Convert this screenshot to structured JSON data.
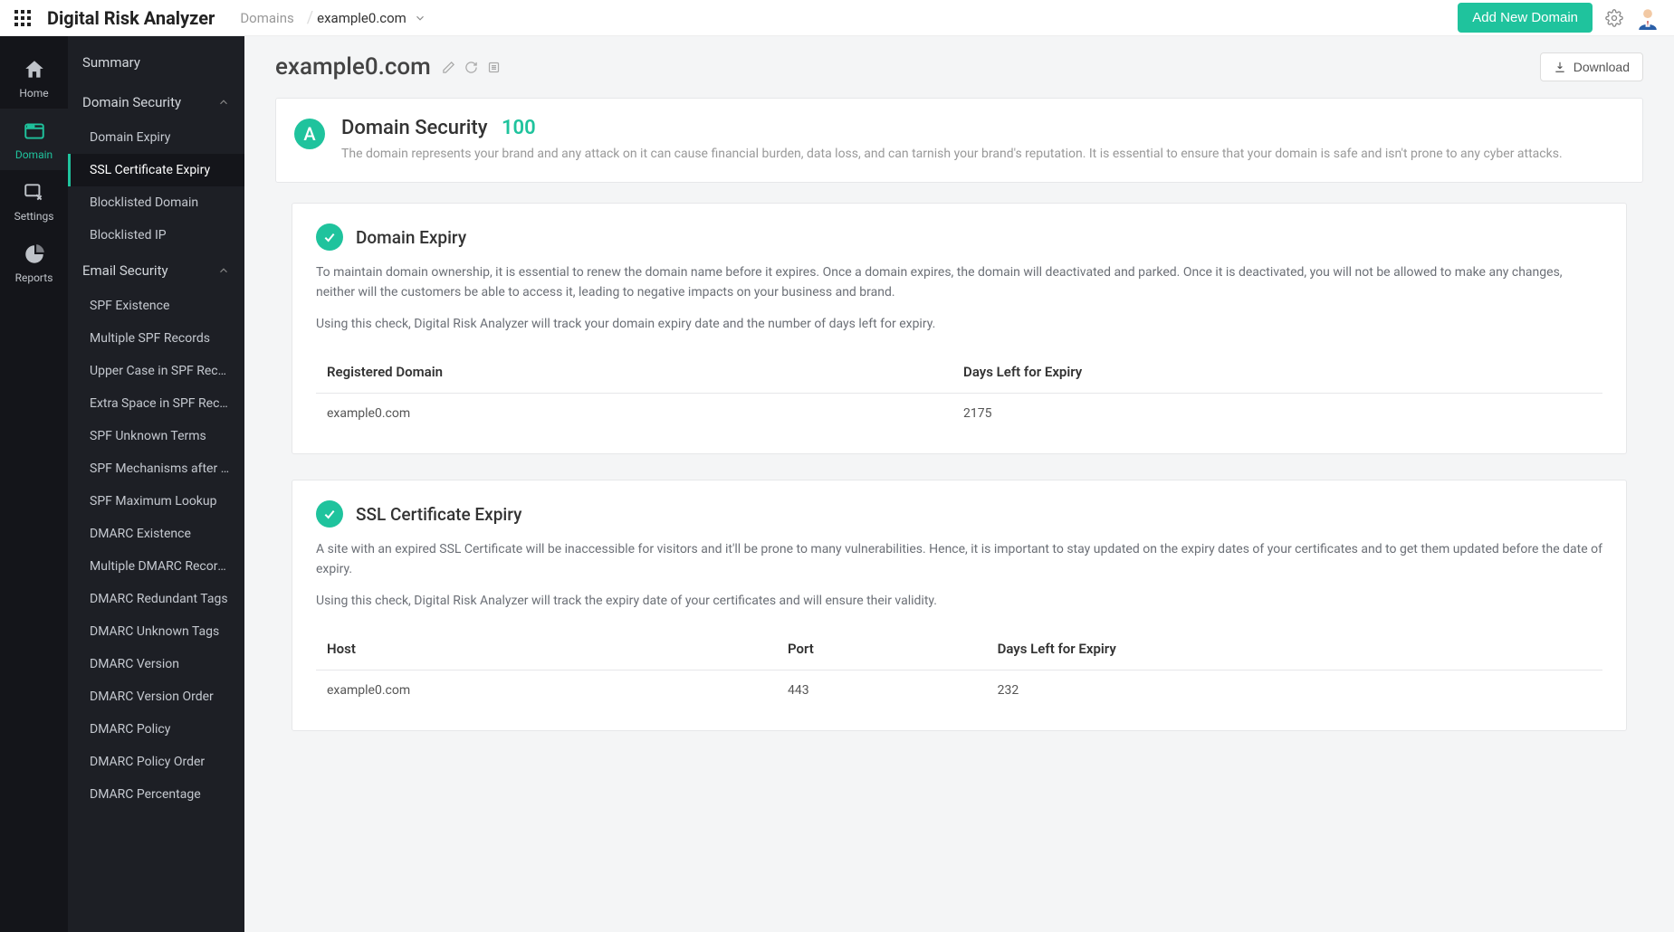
{
  "header": {
    "app_title": "Digital Risk Analyzer",
    "breadcrumb": "Domains",
    "selected_domain": "example0.com",
    "add_button": "Add New Domain"
  },
  "rail": [
    {
      "id": "home",
      "label": "Home"
    },
    {
      "id": "domain",
      "label": "Domain"
    },
    {
      "id": "settings",
      "label": "Settings"
    },
    {
      "id": "reports",
      "label": "Reports"
    }
  ],
  "sidebar": {
    "summary_label": "Summary",
    "groups": [
      {
        "label": "Domain Security",
        "items": [
          "Domain Expiry",
          "SSL Certificate Expiry",
          "Blocklisted Domain",
          "Blocklisted IP"
        ]
      },
      {
        "label": "Email Security",
        "items": [
          "SPF Existence",
          "Multiple SPF Records",
          "Upper Case in SPF Recor...",
          "Extra Space in SPF Record",
          "SPF Unknown Terms",
          "SPF Mechanisms after \"all\"",
          "SPF Maximum Lookup",
          "DMARC Existence",
          "Multiple DMARC Records",
          "DMARC Redundant Tags",
          "DMARC Unknown Tags",
          "DMARC Version",
          "DMARC Version Order",
          "DMARC Policy",
          "DMARC Policy Order",
          "DMARC Percentage"
        ]
      }
    ]
  },
  "page": {
    "title": "example0.com",
    "download_label": "Download"
  },
  "summary": {
    "grade": "A",
    "heading": "Domain Security",
    "score": "100",
    "description": "The domain represents your brand and any attack on it can cause financial burden, data loss, and can tarnish your brand's reputation. It is essential to ensure that your domain is safe and isn't prone to any cyber attacks."
  },
  "checks": [
    {
      "title": "Domain Expiry",
      "desc1": "To maintain domain ownership, it is essential to renew the domain name before it expires. Once a domain expires, the domain will deactivated and parked. Once it is deactivated, you will not be allowed to make any changes, neither will the customers be able to access it, leading to negative impacts on your business and brand.",
      "desc2": "Using this check, Digital Risk Analyzer will track your domain expiry date and the number of days left for expiry.",
      "columns": [
        "Registered Domain",
        "Days Left for Expiry"
      ],
      "rows": [
        [
          "example0.com",
          "2175"
        ]
      ]
    },
    {
      "title": "SSL Certificate Expiry",
      "desc1": "A site with an expired SSL Certificate will be inaccessible for visitors and it'll be prone to many vulnerabilities. Hence, it is important to stay updated on the expiry dates of your certificates and to get them updated before the date of expiry.",
      "desc2": "Using this check, Digital Risk Analyzer will track the expiry date of your certificates and will ensure their validity.",
      "columns": [
        "Host",
        "Port",
        "Days Left for Expiry"
      ],
      "rows": [
        [
          "example0.com",
          "443",
          "232"
        ]
      ]
    }
  ]
}
